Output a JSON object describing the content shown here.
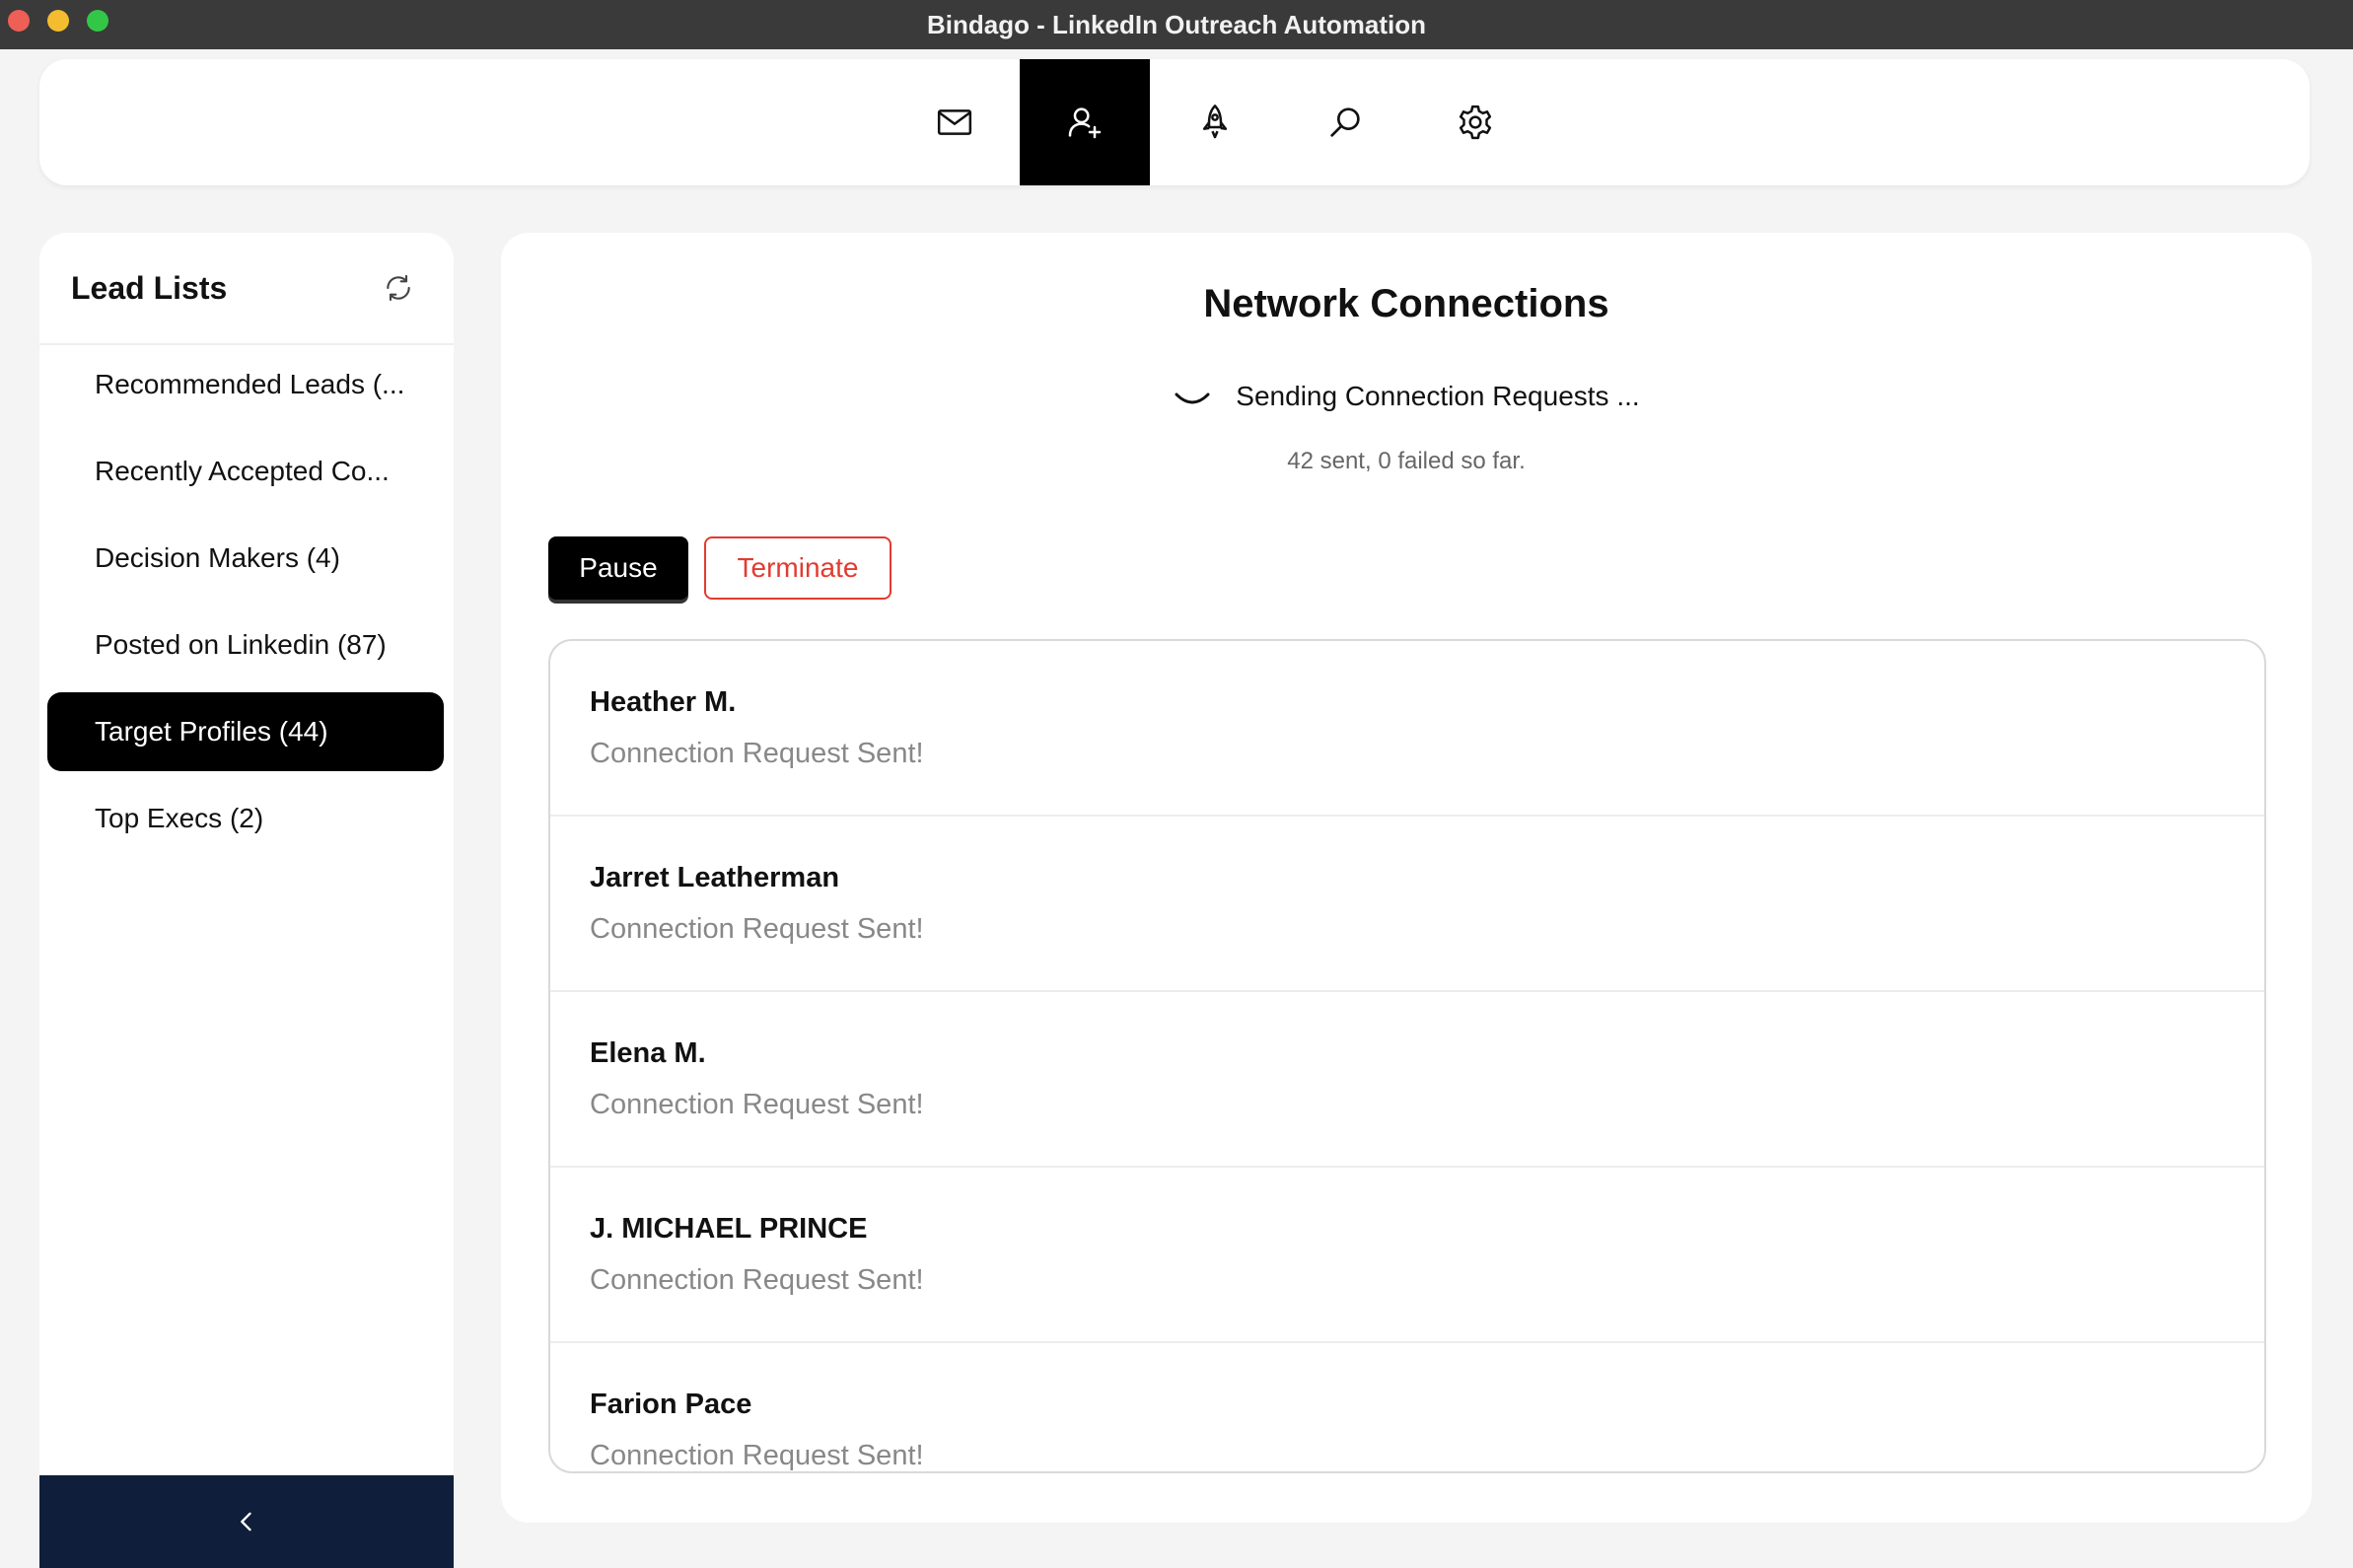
{
  "window": {
    "title": "Bindago - LinkedIn Outreach Automation"
  },
  "topnav": {
    "items": [
      {
        "icon": "mail-icon",
        "active": false
      },
      {
        "icon": "add-person-icon",
        "active": true
      },
      {
        "icon": "rocket-icon",
        "active": false
      },
      {
        "icon": "search-icon",
        "active": false
      },
      {
        "icon": "gear-icon",
        "active": false
      }
    ]
  },
  "sidebar": {
    "title": "Lead Lists",
    "items": [
      {
        "label": "Recommended Leads (..."
      },
      {
        "label": "Recently Accepted Co..."
      },
      {
        "label": "Decision Makers (4)"
      },
      {
        "label": "Posted on Linkedin (87)"
      },
      {
        "label": "Target Profiles (44)",
        "active": true
      },
      {
        "label": "Top Execs (2)"
      }
    ],
    "collapse_icon": "chevron-left-icon"
  },
  "main": {
    "title": "Network Connections",
    "status": "Sending Connection Requests ...",
    "progress": "42 sent, 0 failed so far.",
    "pause_label": "Pause",
    "terminate_label": "Terminate",
    "connections": [
      {
        "name": "Heather M.",
        "status": "Connection Request Sent!"
      },
      {
        "name": "Jarret Leatherman",
        "status": "Connection Request Sent!"
      },
      {
        "name": "Elena M.",
        "status": "Connection Request Sent!"
      },
      {
        "name": "J. MICHAEL PRINCE",
        "status": "Connection Request Sent!"
      },
      {
        "name": "Farion Pace",
        "status": "Connection Request Sent!"
      }
    ]
  },
  "colors": {
    "active": "#000000",
    "danger": "#e23b30",
    "sidebar_footer": "#0f1e3a",
    "muted_text": "#888888"
  }
}
